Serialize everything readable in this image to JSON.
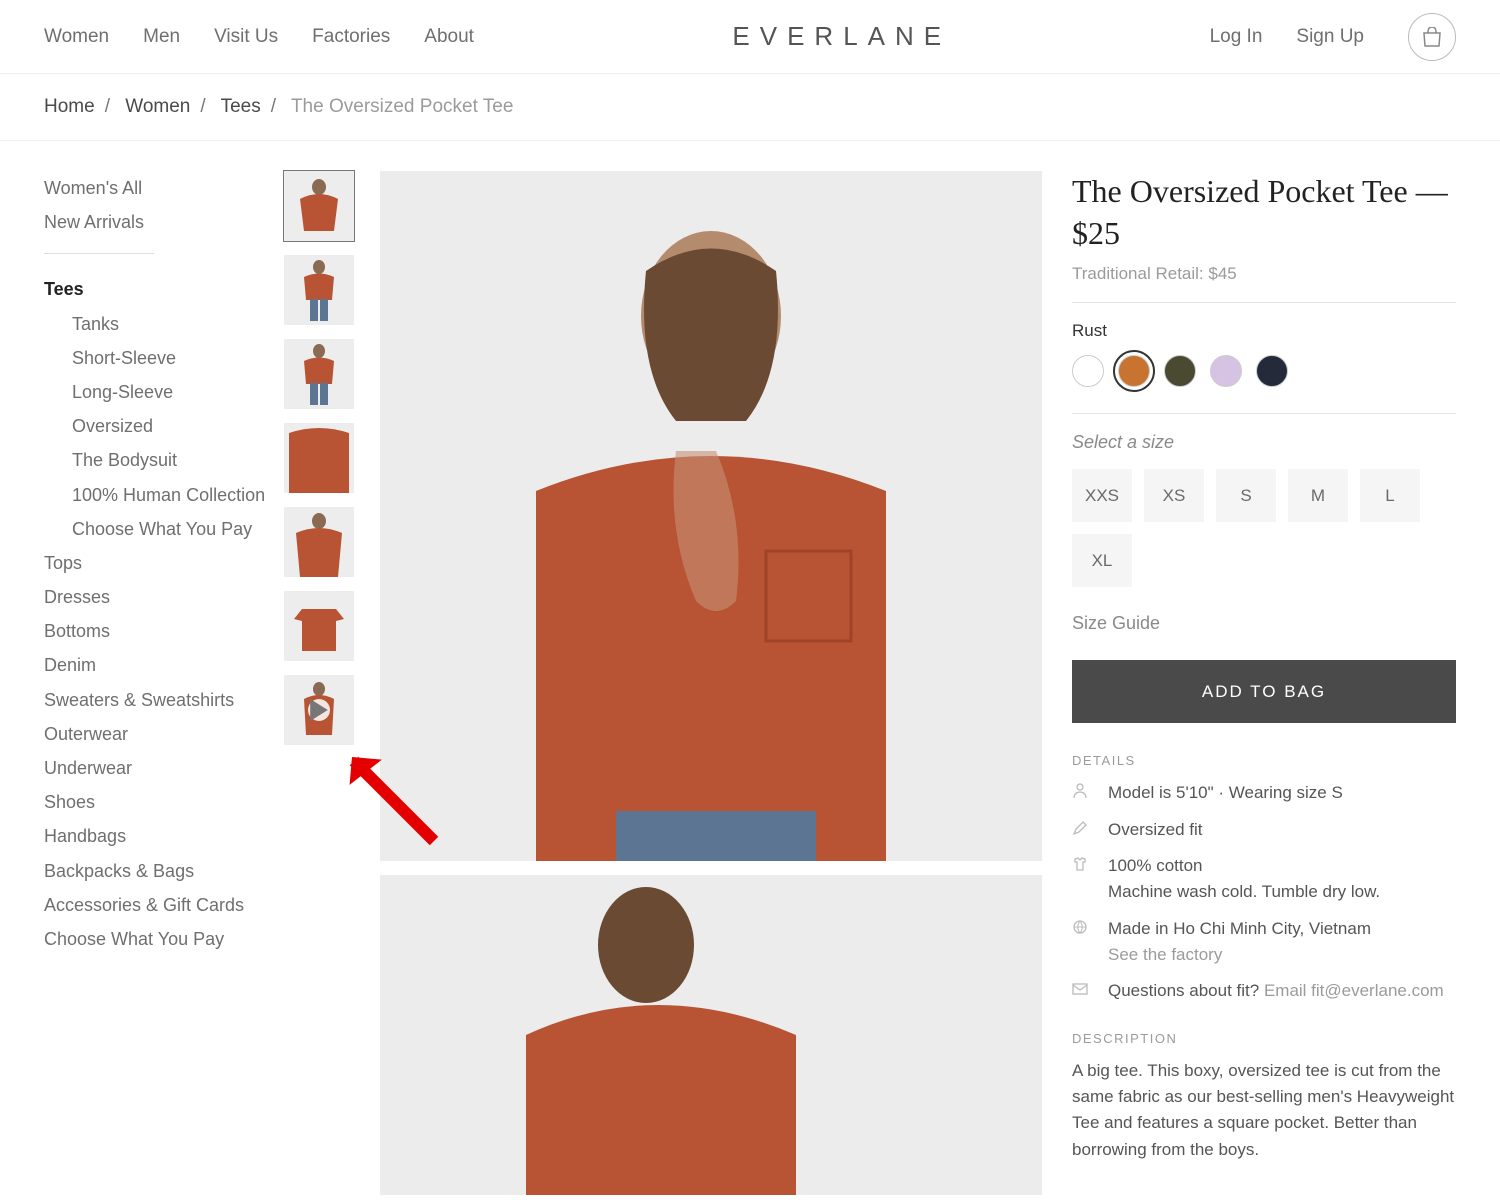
{
  "header": {
    "nav_left": [
      "Women",
      "Men",
      "Visit Us",
      "Factories",
      "About"
    ],
    "logo": "EVERLANE",
    "nav_right": [
      "Log In",
      "Sign Up"
    ]
  },
  "breadcrumb": {
    "items": [
      "Home",
      "Women",
      "Tees"
    ],
    "current": "The Oversized Pocket Tee"
  },
  "sidebar": {
    "top": [
      "Women's All",
      "New Arrivals"
    ],
    "active_category": "Tees",
    "subcategories": [
      "Tanks",
      "Short-Sleeve",
      "Long-Sleeve",
      "Oversized",
      "The Bodysuit",
      "100% Human Collection",
      "Choose What You Pay"
    ],
    "categories": [
      "Tops",
      "Dresses",
      "Bottoms",
      "Denim",
      "Sweaters & Sweatshirts",
      "Outerwear",
      "Underwear",
      "Shoes",
      "Handbags",
      "Backpacks & Bags",
      "Accessories & Gift Cards",
      "Choose What You Pay"
    ]
  },
  "product": {
    "title": "The Oversized Pocket Tee — $25",
    "retail": "Traditional Retail: $45",
    "color_label": "Rust",
    "colors": [
      {
        "hex": "#ffffff"
      },
      {
        "hex": "#c87430",
        "active": true
      },
      {
        "hex": "#4a4a33"
      },
      {
        "hex": "#d6c3e3"
      },
      {
        "hex": "#242a3a"
      }
    ],
    "size_prompt": "Select a size",
    "sizes": [
      "XXS",
      "XS",
      "S",
      "M",
      "L",
      "XL"
    ],
    "size_guide": "Size Guide",
    "add_to_bag": "ADD TO BAG",
    "details_label": "DETAILS",
    "details": {
      "model": "Model is 5'10\"  ·  Wearing size S",
      "fit": "Oversized fit",
      "material": "100% cotton",
      "care": "Machine wash cold. Tumble dry low.",
      "made": "Made in Ho Chi Minh City, Vietnam",
      "factory_link": "See the factory",
      "questions": "Questions about fit? ",
      "email": "Email fit@everlane.com"
    },
    "description_label": "DESCRIPTION",
    "description": "A big tee. This boxy, oversized tee is cut from the same fabric as our best-selling men's Heavyweight Tee and features a square pocket. Better than borrowing from the boys."
  }
}
